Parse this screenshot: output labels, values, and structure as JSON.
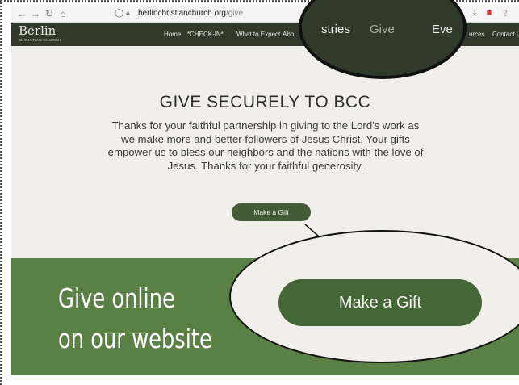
{
  "browser": {
    "url_host": "berlinchristianchurch.org",
    "url_path": "/give",
    "icons": [
      "back-arrow-icon",
      "forward-arrow-icon",
      "reload-icon",
      "home-icon",
      "shield-icon",
      "lock-icon",
      "pocket-icon",
      "download-icon",
      "extension-icon",
      "share-icon"
    ]
  },
  "site": {
    "logo_main": "Berlin",
    "logo_sub": "CHRISTIAN CHURCH",
    "nav": [
      "Home",
      "*CHECK-IN*",
      "What to Expect",
      "Abo",
      "urces",
      "Contact Us"
    ]
  },
  "zoom_top": {
    "items": [
      "stries",
      "Give",
      "Eve"
    ]
  },
  "main": {
    "heading": "GIVE SECURELY TO BCC",
    "paragraph": "Thanks for your faithful partnership in giving to the Lord's work as we make more and better followers of Jesus Christ. Your gifts empower us to bless our neighbors and the nations with the love of Jesus.  Thanks for your faithful generosity.",
    "button": "Make a Gift"
  },
  "band": {
    "line1": "Give online",
    "line2": "on our website",
    "button_zoomed": "Make a Gift"
  },
  "colors": {
    "nav_bg": "#2f3a2a",
    "page_bg": "#f1efe9",
    "button": "#415c36",
    "band": "#5b8046"
  }
}
